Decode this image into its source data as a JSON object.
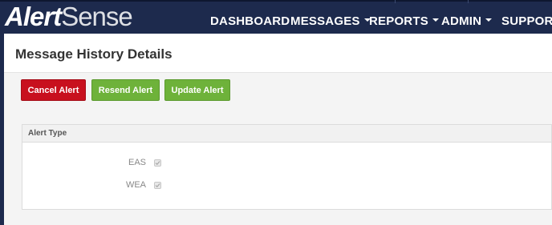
{
  "app": {
    "logo_bold": "Alert",
    "logo_light": "Sense"
  },
  "nav": {
    "items": [
      {
        "label": "DASHBOARD",
        "dropdown": false
      },
      {
        "label": "MESSAGES",
        "dropdown": true
      },
      {
        "label": "REPORTS",
        "dropdown": true
      },
      {
        "label": "ADMIN",
        "dropdown": true
      },
      {
        "label": "SUPPORT",
        "dropdown": false
      }
    ]
  },
  "page": {
    "title": "Message History Details"
  },
  "actions": {
    "cancel_label": "Cancel Alert",
    "resend_label": "Resend Alert",
    "update_label": "Update Alert"
  },
  "alert_type": {
    "heading": "Alert Type",
    "options": [
      {
        "label": "EAS",
        "checked": true,
        "disabled": true
      },
      {
        "label": "WEA",
        "checked": true,
        "disabled": true
      }
    ]
  },
  "colors": {
    "navbar": "#1d2a4d",
    "danger": "#c8101e",
    "success": "#6eb23a"
  },
  "icons": {
    "nav_dropdown": "caret-down-icon",
    "checkbox_mark": "checkmark-icon"
  }
}
